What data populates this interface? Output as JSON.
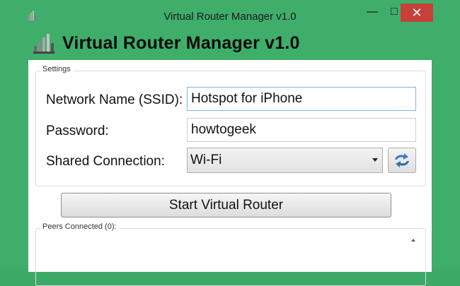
{
  "window": {
    "title": "Virtual Router Manager v1.0",
    "minimize_glyph": "—",
    "maximize_glyph": "□",
    "close_glyph": "✕"
  },
  "header": {
    "app_name": "Virtual Router Manager v1.0",
    "icon": "router-signal-icon"
  },
  "settings": {
    "group_label": "Settings",
    "ssid_label": "Network Name (SSID):",
    "ssid_value": "Hotspot for iPhone",
    "password_label": "Password:",
    "password_value": "howtogeek",
    "shared_label": "Shared Connection:",
    "shared_value": "Wi-Fi",
    "refresh_icon": "refresh-icon"
  },
  "actions": {
    "start_label": "Start Virtual Router"
  },
  "peers": {
    "group_label": "Peers Connected (0):"
  },
  "colors": {
    "window_accent": "#3fae6b",
    "close_button": "#c7403a"
  }
}
